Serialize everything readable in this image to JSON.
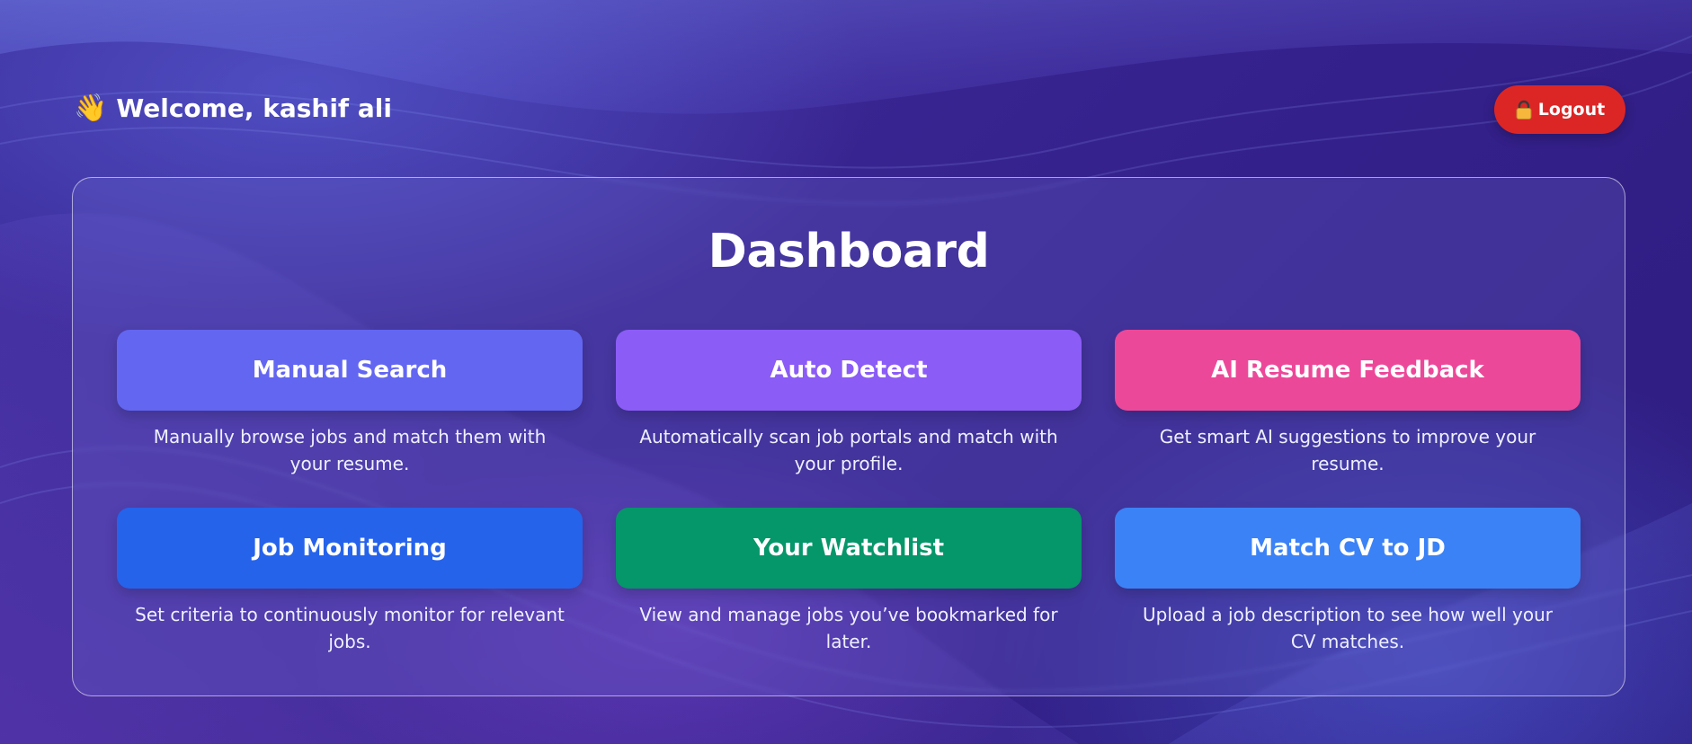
{
  "header": {
    "wave_emoji": "👋",
    "welcome_text": "Welcome, kashif ali"
  },
  "logout": {
    "icon": "lock-icon",
    "label": "Logout",
    "color": "#dc2626"
  },
  "dashboard": {
    "title": "Dashboard",
    "cards": [
      {
        "label": "Manual Search",
        "description": "Manually browse jobs and match them with your resume.",
        "color": "#6366f1"
      },
      {
        "label": "Auto Detect",
        "description": "Automatically scan job portals and match with your profile.",
        "color": "#8b5cf6"
      },
      {
        "label": "AI Resume Feedback",
        "description": "Get smart AI suggestions to improve your resume.",
        "color": "#ec4899"
      },
      {
        "label": "Job Monitoring",
        "description": "Set criteria to continuously monitor for relevant jobs.",
        "color": "#2563eb"
      },
      {
        "label": "Your Watchlist",
        "description": "View and manage jobs you’ve bookmarked for later.",
        "color": "#059669"
      },
      {
        "label": "Match CV to JD",
        "description": "Upload a job description to see how well your CV matches.",
        "color": "#3b82f6"
      }
    ]
  }
}
